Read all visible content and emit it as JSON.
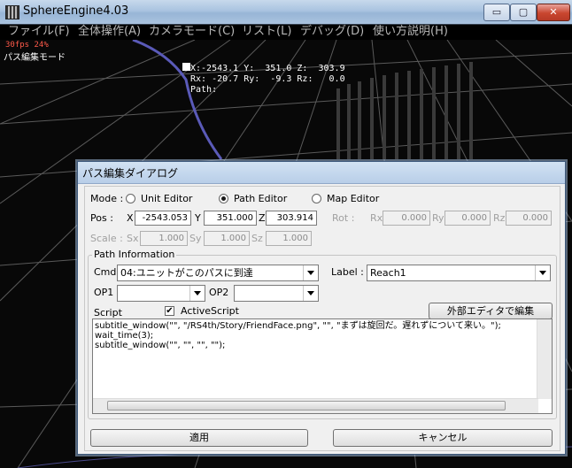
{
  "window": {
    "title": "SphereEngine4.03",
    "minimize": "▭",
    "maximize": "▢",
    "close": "✕"
  },
  "menu": [
    "ファイル(F)",
    "全体操作(A)",
    "カメラモード(C)",
    "リスト(L)",
    "デバッグ(D)",
    "使い方説明(H)"
  ],
  "hud": {
    "fps": "30fps 24%",
    "mode": "パス編集モード",
    "line1": "X:-2543.1 Y:  351.0 Z:  303.9",
    "line2": "Rx: -20.7 Ry:  -9.3 Rz:   0.0",
    "line3": "Path:"
  },
  "dialog": {
    "title": "パス編集ダイアログ",
    "mode_label": "Mode :",
    "modes": [
      "Unit Editor",
      "Path Editor",
      "Map Editor"
    ],
    "selected_mode": "Path Editor",
    "pos_label": "Pos :",
    "pos": {
      "x_label": "X",
      "x": "-2543.053",
      "y_label": "Y",
      "y": "351.000",
      "z_label": "Z",
      "z": "303.914"
    },
    "rot_label": "Rot :",
    "rot": {
      "rx_label": "Rx",
      "rx": "0.000",
      "ry_label": "Ry",
      "ry": "0.000",
      "rz_label": "Rz",
      "rz": "0.000"
    },
    "scale_label": "Scale :",
    "scale": {
      "sx_label": "Sx",
      "sx": "1.000",
      "sy_label": "Sy",
      "sy": "1.000",
      "sz_label": "Sz",
      "sz": "1.000"
    },
    "path_info": {
      "group_label": "Path Information",
      "cmd_label": "Cmd",
      "cmd_value": "04:ユニットがこのパスに到達",
      "label_label": "Label :",
      "label_value": "Reach1",
      "op1_label": "OP1",
      "op1_value": "",
      "op2_label": "OP2",
      "op2_value": "",
      "script_label": "Script",
      "active_script_label": "ActiveScript",
      "active_script_checked": true,
      "external_editor_button": "外部エディタで編集",
      "script_text": "subtitle_window(\"\", \"/RS4th/Story/FriendFace.png\", \"\", \"まずは旋回だ。遅れずについて来い。\");\nwait_time(3);\nsubtitle_window(\"\", \"\", \"\", \"\");"
    },
    "apply_button": "適用",
    "cancel_button": "キャンセル"
  }
}
